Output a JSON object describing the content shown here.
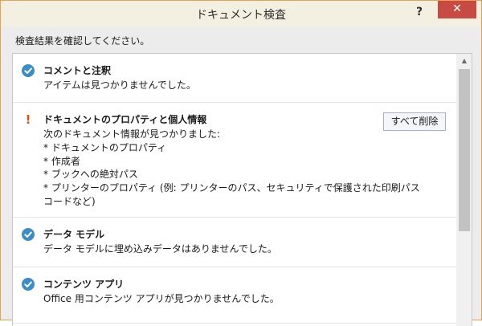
{
  "window": {
    "title": "ドキュメント検査",
    "help_glyph": "?",
    "close_glyph": "✕"
  },
  "instruction": "検査結果を確認してください。",
  "results": [
    {
      "status": "ok",
      "status_icon": "check-circle-icon",
      "title": "コメントと注釈",
      "description": "アイテムは見つかりませんでした。"
    },
    {
      "status": "warning",
      "status_icon": "exclamation-icon",
      "status_glyph": "!",
      "title": "ドキュメントのプロパティと個人情報",
      "description_lines": [
        "次のドキュメント情報が見つかりました:",
        "* ドキュメントのプロパティ",
        "* 作成者",
        "* ブックへの絶対パス",
        "* プリンターのプロパティ (例: プリンターのパス、セキュリティで保護された印刷パス",
        "コードなど)"
      ],
      "action_label": "すべて削除"
    },
    {
      "status": "ok",
      "status_icon": "check-circle-icon",
      "title": "データ モデル",
      "description": "データ モデルに埋め込みデータはありませんでした。"
    },
    {
      "status": "ok",
      "status_icon": "check-circle-icon",
      "title": "コンテンツ アプリ",
      "description": "Office 用コンテンツ アプリが見つかりませんでした。"
    }
  ],
  "scrollbar": {
    "up_glyph": "▲"
  },
  "colors": {
    "ok_icon": "#3c8dc5",
    "warning_icon": "#d9541e",
    "close_button": "#c74b43",
    "titlebar": "#f3f0e2",
    "window_border": "#e8a055",
    "button_border": "#9cb4cf"
  }
}
